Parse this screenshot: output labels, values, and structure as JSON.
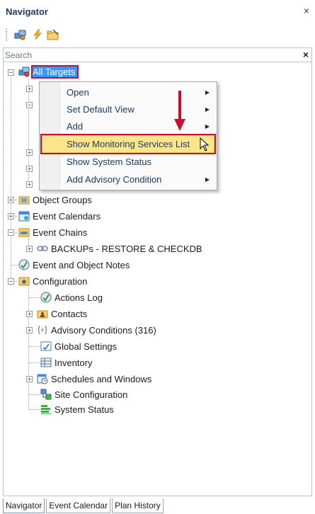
{
  "pane": {
    "title": "Navigator",
    "close_glyph": "×"
  },
  "toolbar": {
    "buttons": [
      {
        "name": "targets-icon"
      },
      {
        "name": "lightning-icon"
      },
      {
        "name": "folder-note-icon"
      }
    ]
  },
  "search": {
    "placeholder": "Search",
    "value": "",
    "clear_glyph": "×"
  },
  "tree": {
    "root": {
      "label": "All Targets",
      "expander": "−"
    },
    "collapsed_children_count": 5,
    "items": [
      {
        "label": "Object Groups",
        "icon": "object-groups-icon",
        "expander": "+"
      },
      {
        "label": "Event Calendars",
        "icon": "calendar-icon",
        "expander": "+"
      },
      {
        "label": "Event Chains",
        "icon": "event-chains-icon",
        "expander": "−"
      },
      {
        "label": "BACKUPs - RESTORE & CHECKDB",
        "icon": "chain-icon",
        "expander": "+"
      },
      {
        "label": "Event and Object Notes",
        "icon": "notes-icon",
        "expander": ""
      },
      {
        "label": "Configuration",
        "icon": "configuration-icon",
        "expander": "−"
      },
      {
        "label": "Actions Log",
        "icon": "actions-log-icon",
        "expander": ""
      },
      {
        "label": "Contacts",
        "icon": "contacts-icon",
        "expander": "+"
      },
      {
        "label": "Advisory Conditions (316)",
        "icon": "advisory-icon",
        "expander": "+"
      },
      {
        "label": "Global Settings",
        "icon": "global-settings-icon",
        "expander": ""
      },
      {
        "label": "Inventory",
        "icon": "inventory-icon",
        "expander": ""
      },
      {
        "label": "Schedules and Windows",
        "icon": "schedules-icon",
        "expander": "+"
      },
      {
        "label": "Site Configuration",
        "icon": "site-configuration-icon",
        "expander": ""
      },
      {
        "label": "System Status",
        "icon": "system-status-icon",
        "expander": ""
      }
    ]
  },
  "context_menu": {
    "items": [
      {
        "label": "Open",
        "submenu": "▶"
      },
      {
        "label": "Set Default View",
        "submenu": "▶"
      },
      {
        "label": "Add",
        "submenu": "▶"
      },
      {
        "label": "Show Monitoring Services List",
        "submenu": "",
        "highlighted": true
      },
      {
        "label": "Show System Status",
        "submenu": ""
      },
      {
        "label": "Add Advisory Condition",
        "submenu": "▶"
      }
    ]
  },
  "tabs": [
    {
      "label": "Navigator",
      "active": true
    },
    {
      "label": "Event Calendar",
      "active": false
    },
    {
      "label": "Plan History",
      "active": false
    }
  ],
  "colors": {
    "selection": "#3399ff",
    "annotation_red": "#c8102e",
    "menu_highlight": "#fde68a",
    "title_text": "#1e395b"
  }
}
